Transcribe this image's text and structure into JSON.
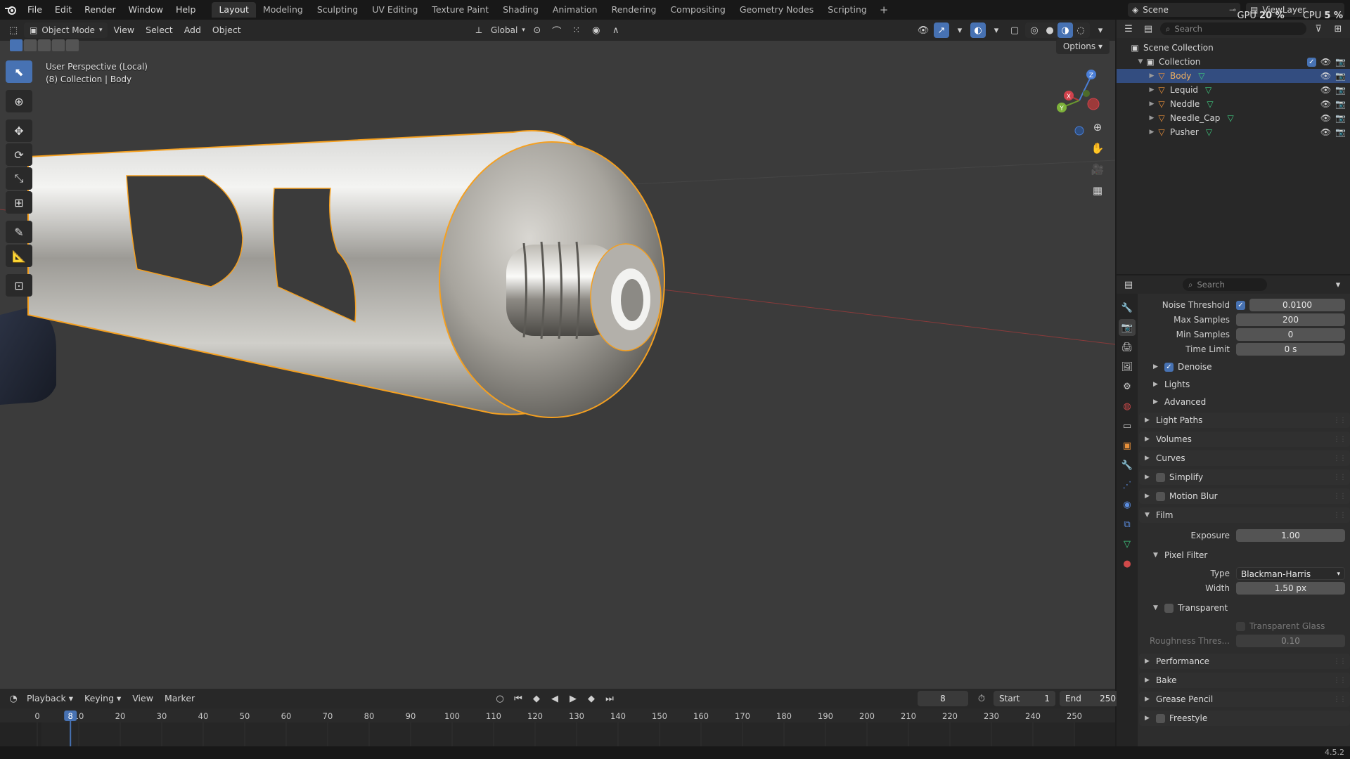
{
  "topbar": {
    "menus": [
      "File",
      "Edit",
      "Render",
      "Window",
      "Help"
    ],
    "workspaces": [
      "Layout",
      "Modeling",
      "Sculpting",
      "UV Editing",
      "Texture Paint",
      "Shading",
      "Animation",
      "Rendering",
      "Compositing",
      "Geometry Nodes",
      "Scripting"
    ],
    "active_workspace": "Layout",
    "scene": "Scene",
    "view_layer": "ViewLayer",
    "gpu_label": "GPU",
    "gpu_value": "20 %",
    "cpu_label": "CPU",
    "cpu_value": "5 %"
  },
  "viewport": {
    "mode": "Object Mode",
    "menus": [
      "View",
      "Select",
      "Add",
      "Object"
    ],
    "orientation": "Global",
    "options_label": "Options",
    "info_line1": "User Perspective (Local)",
    "info_line2": "(8) Collection | Body",
    "gizmo_axes": [
      "X",
      "Y",
      "Z"
    ]
  },
  "outliner": {
    "search_placeholder": "Search",
    "scene_collection": "Scene Collection",
    "collection": "Collection",
    "objects": [
      {
        "name": "Body",
        "selected": true
      },
      {
        "name": "Lequid",
        "selected": false
      },
      {
        "name": "Neddle",
        "selected": false
      },
      {
        "name": "Needle_Cap",
        "selected": false
      },
      {
        "name": "Pusher",
        "selected": false
      }
    ]
  },
  "properties": {
    "search_placeholder": "Search",
    "noise_threshold_label": "Noise Threshold",
    "noise_threshold_value": "0.0100",
    "max_samples_label": "Max Samples",
    "max_samples_value": "200",
    "min_samples_label": "Min Samples",
    "min_samples_value": "0",
    "time_limit_label": "Time Limit",
    "time_limit_value": "0 s",
    "denoise_label": "Denoise",
    "lights_label": "Lights",
    "advanced_label": "Advanced",
    "panels_top": [
      "Light Paths",
      "Volumes",
      "Curves",
      "Simplify",
      "Motion Blur"
    ],
    "film_label": "Film",
    "exposure_label": "Exposure",
    "exposure_value": "1.00",
    "pixel_filter_label": "Pixel Filter",
    "type_label": "Type",
    "type_value": "Blackman-Harris",
    "width_label": "Width",
    "width_value": "1.50 px",
    "transparent_label": "Transparent",
    "transparent_glass_label": "Transparent Glass",
    "roughness_label": "Roughness Thres...",
    "roughness_value": "0.10",
    "panels_bottom": [
      "Performance",
      "Bake",
      "Grease Pencil",
      "Freestyle"
    ]
  },
  "timeline": {
    "menus": [
      "Playback",
      "Keying",
      "View",
      "Marker"
    ],
    "current_frame": "8",
    "start_label": "Start",
    "start_value": "1",
    "end_label": "End",
    "end_value": "250",
    "ticks": [
      "0",
      "10",
      "20",
      "30",
      "40",
      "50",
      "60",
      "70",
      "80",
      "90",
      "100",
      "110",
      "120",
      "130",
      "140",
      "150",
      "160",
      "170",
      "180",
      "190",
      "200",
      "210",
      "220",
      "230",
      "240",
      "250"
    ],
    "playhead_label": "8"
  },
  "statusbar": {
    "version": "4.5.2"
  },
  "colors": {
    "accent": "#4772b3",
    "selection_outline": "#f5a020",
    "selected_row": "#334d80",
    "mesh_icon": "#3ec47d",
    "object_icon": "#e8903a"
  }
}
